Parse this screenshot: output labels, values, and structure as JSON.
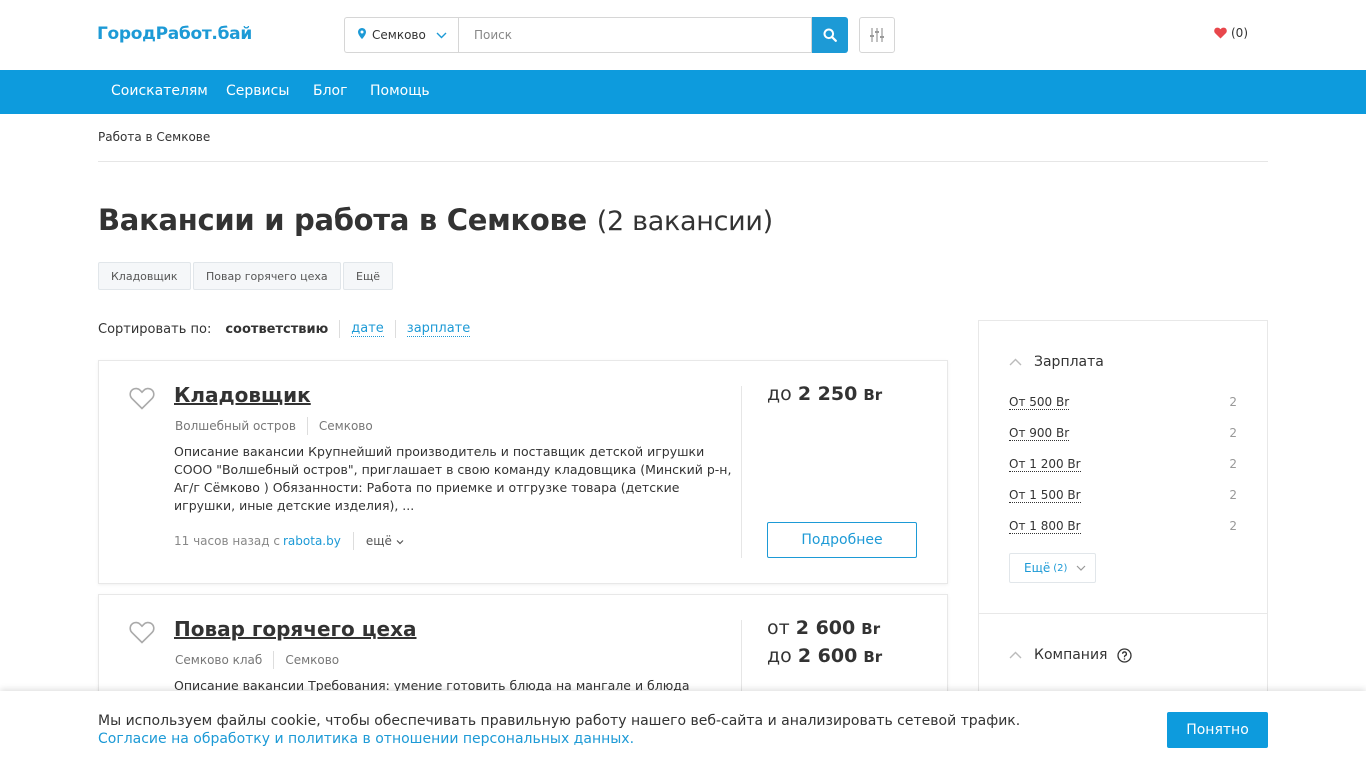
{
  "header": {
    "logo": "ГородРабот.бай",
    "city": "Семково",
    "search_placeholder": "Поиск",
    "favorites_count": "(0)"
  },
  "nav": {
    "items": [
      "Соискателям",
      "Сервисы",
      "Блог",
      "Помощь"
    ]
  },
  "breadcrumb": "Работа в Семкове",
  "page": {
    "title": "Вакансии и работа в Семкове",
    "count": "(2 вакансии)"
  },
  "tags": [
    "Кладовщик",
    "Повар горячего цеха",
    "Ещё"
  ],
  "sort": {
    "label": "Сортировать по:",
    "active": "соответствию",
    "options": [
      "дате",
      "зарплате"
    ]
  },
  "vacancies": [
    {
      "title": "Кладовщик",
      "company": "Волшебный остров",
      "location": "Семково",
      "description": "Описание вакансии Крупнейший производитель и поставщик детской игрушки СООО \"Волшебный остров\", приглашает в свою команду кладовщика (Минский р-н, Аг/г Сёмково ) Обязанности: Работа по приемке и отгрузке товара (детские игрушки, иные детские изделия), ...",
      "posted": "11 часов назад с",
      "source": "rabota.by",
      "more": "ещё",
      "salary_prefix": "до",
      "salary_value": "2 250",
      "currency": "Br",
      "details_button": "Подробнее"
    },
    {
      "title": "Повар горячего цеха",
      "company": "Семково клаб",
      "location": "Семково",
      "description": "Описание вакансии Требования: умение готовить блюда на мангале и блюда",
      "salary_from_prefix": "от",
      "salary_from": "2 600",
      "salary_to_prefix": "до",
      "salary_to": "2 600",
      "currency": "Br"
    }
  ],
  "sidebar": {
    "salary_title": "Зарплата",
    "salary_filters": [
      {
        "label": "От 500 Br",
        "count": "2"
      },
      {
        "label": "От 900 Br",
        "count": "2"
      },
      {
        "label": "От 1 200 Br",
        "count": "2"
      },
      {
        "label": "От 1 500 Br",
        "count": "2"
      },
      {
        "label": "От 1 800 Br",
        "count": "2"
      }
    ],
    "more_label": "Ещё",
    "more_count": "(2)",
    "company_title": "Компания"
  },
  "cookie": {
    "text": "Мы используем файлы cookie, чтобы обеспечивать правильную работу нашего веб-сайта и анализировать сетевой трафик.",
    "link": "Согласие на обработку и политика в отношении персональных данных.",
    "button": "Понятно"
  },
  "colors": {
    "accent": "#0d9bdd",
    "link": "#1d9ad6",
    "heart": "#e8474c"
  }
}
